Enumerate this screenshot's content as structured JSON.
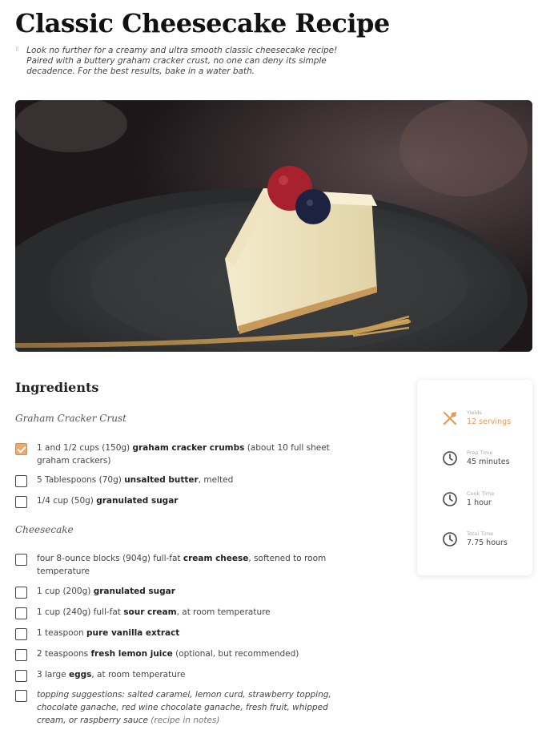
{
  "page": {
    "title": "Classic Cheesecake Recipe",
    "intro": "Look no further for a creamy and ultra smooth classic cheesecake recipe! Paired with a buttery graham cracker crust, no one can deny its simple decadence. For the best results, bake in a water bath."
  },
  "ingredients": {
    "heading": "Ingredients",
    "groups": [
      {
        "title": "Graham Cracker Crust",
        "items": [
          {
            "checked": true,
            "pre": "1 and 1/2 cups (150g) ",
            "bold": "graham cracker crumbs",
            "post": " (about 10 full sheet graham crackers)"
          },
          {
            "checked": false,
            "pre": "5 Tablespoons (70g) ",
            "bold": "unsalted butter",
            "post": ", melted"
          },
          {
            "checked": false,
            "pre": "1/4 cup (50g) ",
            "bold": "granulated sugar",
            "post": ""
          }
        ]
      },
      {
        "title": "Cheesecake",
        "items": [
          {
            "checked": false,
            "pre": "four 8-ounce blocks (904g) full-fat ",
            "bold": "cream cheese",
            "post": ", softened to room temperature"
          },
          {
            "checked": false,
            "pre": "1 cup (200g) ",
            "bold": "granulated sugar",
            "post": ""
          },
          {
            "checked": false,
            "pre": "1 cup (240g) full-fat ",
            "bold": "sour cream",
            "post": ", at room temperature"
          },
          {
            "checked": false,
            "pre": "1 teaspoon ",
            "bold": "pure vanilla extract",
            "post": ""
          },
          {
            "checked": false,
            "pre": "2 teaspoons ",
            "bold": "fresh lemon juice",
            "post": " (optional, but recommended)"
          },
          {
            "checked": false,
            "pre": "3 large ",
            "bold": "eggs",
            "post": ", at room temperature"
          },
          {
            "checked": false,
            "italic": true,
            "text": "topping suggestions: salted caramel, lemon curd, strawberry topping, chocolate ganache, red wine chocolate ganache, fresh fruit, whipped cream, or raspberry sauce",
            "post_italic": " (recipe in notes)"
          }
        ]
      }
    ]
  },
  "info_card": {
    "yields": {
      "label": "Yields",
      "value": "12 servings",
      "icon": "utensils-icon"
    },
    "prep": {
      "label": "Prep Time",
      "value": "45 minutes",
      "icon": "clock-icon"
    },
    "cook": {
      "label": "Cook Time",
      "value": "1 hour",
      "icon": "clock-icon"
    },
    "total": {
      "label": "Total Time",
      "value": "7.75 hours",
      "icon": "clock-icon"
    }
  },
  "colors": {
    "accent": "#e89a55",
    "checkbox_checked": "#f0a868"
  }
}
